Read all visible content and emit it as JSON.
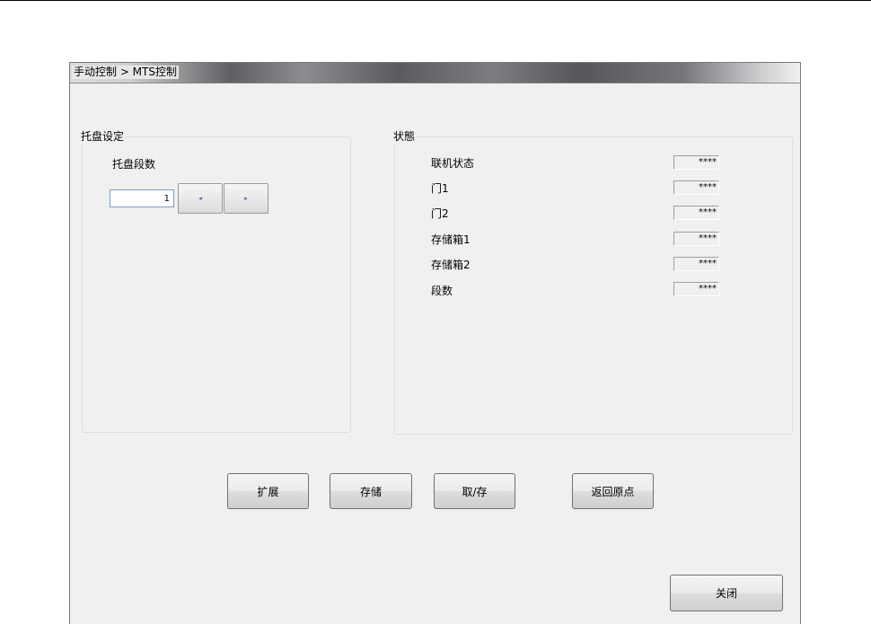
{
  "window": {
    "breadcrumb": "手动控制 > MTS控制"
  },
  "pallet_setting": {
    "caption": "托盘设定",
    "stage_label": "托盘段数",
    "stage_value": "1",
    "decrease_glyph": "◂",
    "increase_glyph": "▸"
  },
  "status": {
    "caption": "状態",
    "rows": [
      {
        "label": "联机状态",
        "value": "****"
      },
      {
        "label": "门1",
        "value": "****"
      },
      {
        "label": "门2",
        "value": "****"
      },
      {
        "label": "存储箱1",
        "value": "****"
      },
      {
        "label": "存储箱2",
        "value": "****"
      },
      {
        "label": "段数",
        "value": "****"
      }
    ]
  },
  "actions": {
    "extend": "扩展",
    "store": "存储",
    "take_store": "取/存",
    "return_origin": "返回原点",
    "close": "关闭"
  }
}
